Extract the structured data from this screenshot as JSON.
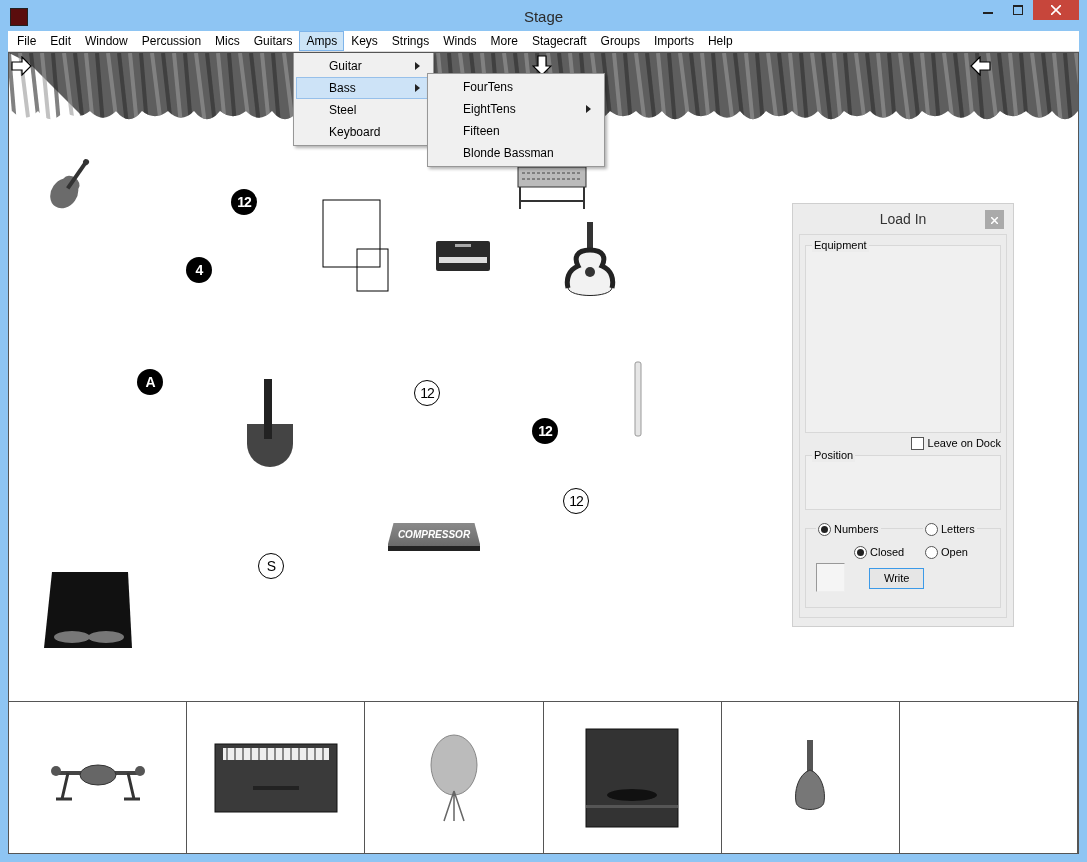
{
  "window": {
    "title": "Stage"
  },
  "menu": [
    {
      "label": "File",
      "selected": false
    },
    {
      "label": "Edit",
      "selected": false
    },
    {
      "label": "Window",
      "selected": false
    },
    {
      "label": "Percussion",
      "selected": false
    },
    {
      "label": "Mics",
      "selected": false
    },
    {
      "label": "Guitars",
      "selected": false
    },
    {
      "label": "Amps",
      "selected": true
    },
    {
      "label": "Keys",
      "selected": false
    },
    {
      "label": "Strings",
      "selected": false
    },
    {
      "label": "Winds",
      "selected": false
    },
    {
      "label": "More",
      "selected": false
    },
    {
      "label": "Stagecraft",
      "selected": false
    },
    {
      "label": "Groups",
      "selected": false
    },
    {
      "label": "Imports",
      "selected": false
    },
    {
      "label": "Help",
      "selected": false
    }
  ],
  "amps_menu": [
    {
      "label": "Guitar",
      "submenu": true,
      "selected": false
    },
    {
      "label": "Bass",
      "submenu": true,
      "selected": true
    },
    {
      "label": "Steel",
      "submenu": false,
      "selected": false
    },
    {
      "label": "Keyboard",
      "submenu": false,
      "selected": false
    }
  ],
  "bass_submenu": [
    {
      "label": "FourTens",
      "submenu": false
    },
    {
      "label": "EightTens",
      "submenu": true
    },
    {
      "label": "Fifteen",
      "submenu": false
    },
    {
      "label": "Blonde Bassman",
      "submenu": false
    }
  ],
  "stage": {
    "markers": [
      {
        "text": "12",
        "kind": "filled"
      },
      {
        "text": "4",
        "kind": "filled"
      },
      {
        "text": "A",
        "kind": "filled"
      },
      {
        "text": "12",
        "kind": "outline"
      },
      {
        "text": "12",
        "kind": "filled"
      },
      {
        "text": "12",
        "kind": "outline"
      },
      {
        "text": "S",
        "kind": "outline"
      }
    ],
    "items": [
      {
        "kind": "violin"
      },
      {
        "kind": "squares"
      },
      {
        "kind": "amp"
      },
      {
        "kind": "stand"
      },
      {
        "kind": "guitar"
      },
      {
        "kind": "paddle"
      },
      {
        "kind": "recorder"
      },
      {
        "kind": "rack",
        "label": "COMPRESSOR"
      },
      {
        "kind": "cabinet"
      }
    ]
  },
  "load_in": {
    "title": "Load In",
    "equipment": "Equipment",
    "leave_on_dock": {
      "label": "Leave on Dock",
      "checked": false
    },
    "position": "Position",
    "mode": [
      {
        "label": "Numbers",
        "selected": true
      },
      {
        "label": "Letters",
        "selected": false
      }
    ],
    "style": [
      {
        "label": "Closed",
        "selected": true
      },
      {
        "label": "Open",
        "selected": false
      }
    ],
    "write": "Write"
  },
  "dock": [
    {
      "kind": "stand"
    },
    {
      "kind": "keyboard-amp"
    },
    {
      "kind": "cymbal"
    },
    {
      "kind": "cabinet"
    },
    {
      "kind": "mandolin"
    },
    {
      "kind": "empty"
    }
  ]
}
